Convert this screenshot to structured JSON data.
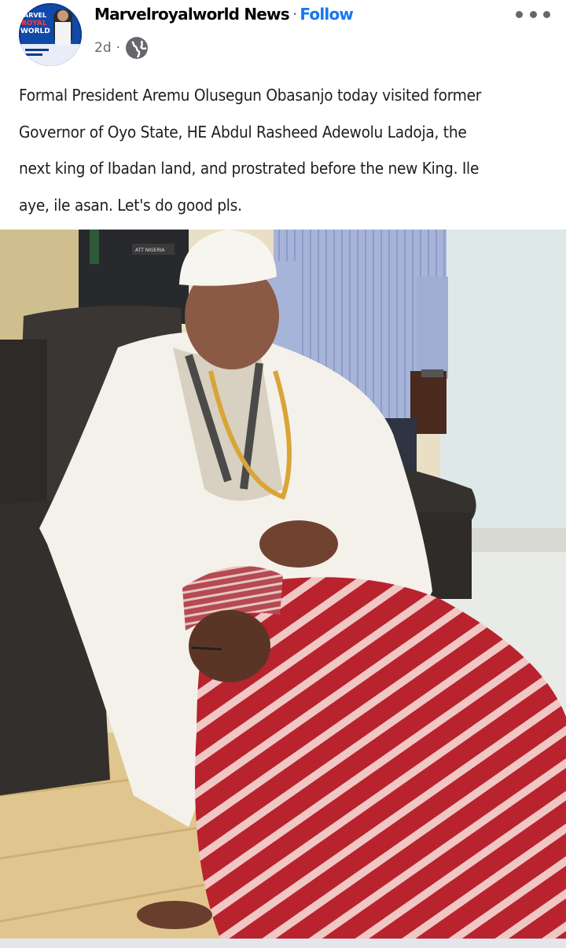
{
  "post": {
    "page_name": "Marvelroyalworld News",
    "separator": "·",
    "follow_label": "Follow",
    "age": "2d",
    "age_separator": "·",
    "privacy_icon": "globe-icon",
    "more_icon": "more-options-icon",
    "avatar_text": [
      "ARVEL",
      "ROYAL",
      "WORLD"
    ],
    "caption_lines": [
      "Formal President Aremu Olusegun Obasanjo today visited former",
      "Governor of Oyo State, HE  Abdul Rasheed Adewolu Ladoja, the",
      "next king of Ibadan land, and prostrated before the new King.  Ile",
      "aye, ile asan. Let's do good pls."
    ]
  },
  "photo": {
    "uniform_badge_text": "ATT NIGERIA"
  },
  "colors": {
    "accent": "#1877f2",
    "muted": "#65676b",
    "text": "#050505"
  }
}
